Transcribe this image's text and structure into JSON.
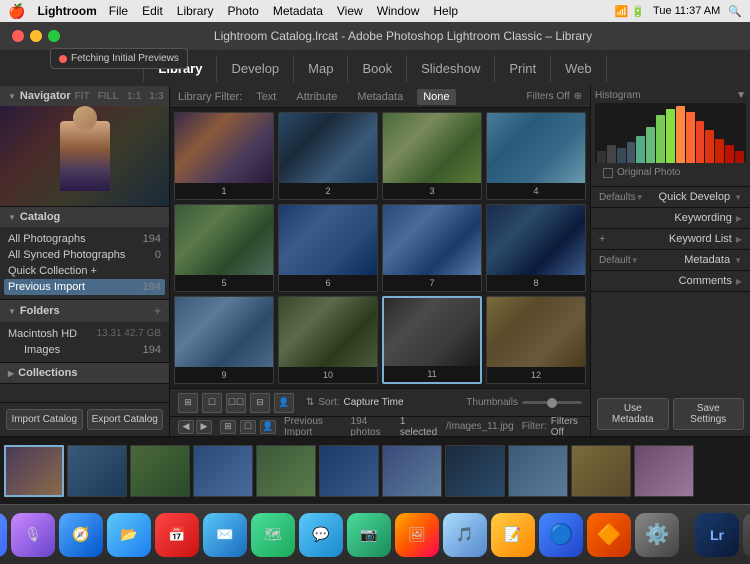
{
  "menubar": {
    "apple": "🍎",
    "app_name": "Lightroom",
    "menus": [
      "File",
      "Edit",
      "Library",
      "Photo",
      "Metadata",
      "View",
      "Window",
      "Help"
    ],
    "clock": "Tue 11:37 AM"
  },
  "titlebar": {
    "title": "Lightroom Catalog.lrcat - Adobe Photoshop Lightroom Classic – Library"
  },
  "notification": {
    "text": "Fetching Initial Previews"
  },
  "module_tabs": {
    "items": [
      "Library",
      "Develop",
      "Map",
      "Book",
      "Slideshow",
      "Print",
      "Web"
    ],
    "active": "Library"
  },
  "navigator": {
    "label": "Navigator",
    "zoom_levels": [
      "FIT",
      "FILL",
      "1:1",
      "1:3"
    ]
  },
  "catalog": {
    "label": "Catalog",
    "items": [
      {
        "name": "All Photographs",
        "count": "194"
      },
      {
        "name": "All Synced Photographs",
        "count": "0"
      },
      {
        "name": "Quick Collection +",
        "count": ""
      },
      {
        "name": "Previous Import",
        "count": "194"
      }
    ]
  },
  "folders": {
    "label": "Folders",
    "items": [
      {
        "name": "Macintosh HD",
        "info": "13.31 42.7 GB"
      },
      {
        "name": "Images",
        "count": "194",
        "indent": true
      }
    ]
  },
  "collections": {
    "label": "Collections"
  },
  "bottom_buttons": {
    "import": "Import Catalog",
    "export": "Export Catalog"
  },
  "filter_bar": {
    "label": "Library Filter:",
    "options": [
      "Text",
      "Attribute",
      "Metadata",
      "None"
    ],
    "active": "None",
    "right": "Filters Off"
  },
  "grid": {
    "cells": [
      {
        "num": "1",
        "class": "thumb-1"
      },
      {
        "num": "2",
        "class": "thumb-2"
      },
      {
        "num": "3",
        "class": "thumb-3"
      },
      {
        "num": "4",
        "class": "thumb-4"
      },
      {
        "num": "5",
        "class": "thumb-5"
      },
      {
        "num": "6",
        "class": "thumb-6"
      },
      {
        "num": "7",
        "class": "thumb-7"
      },
      {
        "num": "8",
        "class": "thumb-8"
      },
      {
        "num": "9",
        "class": "thumb-9"
      },
      {
        "num": "10",
        "class": "thumb-10"
      },
      {
        "num": "11",
        "class": "thumb-11"
      },
      {
        "num": "12",
        "class": "thumb-12"
      }
    ],
    "selected_index": 10
  },
  "grid_toolbar": {
    "sort_label": "Sort:",
    "sort_value": "Capture Time",
    "thumbnail_label": "Thumbnails"
  },
  "status_bar": {
    "prev_label": "Previous Import",
    "count": "194 photos",
    "selected": "1 selected",
    "filename": "/Images_11.jpg",
    "filter_label": "Filter:",
    "filter_value": "Filters Off"
  },
  "histogram": {
    "label": "Histogram",
    "original_photo_label": "Original Photo"
  },
  "right_options": [
    {
      "key": "Defaults",
      "label": "Quick Develop",
      "type": "dropdown"
    },
    {
      "key": "",
      "label": "Keywording",
      "type": "expand"
    },
    {
      "key": "",
      "label": "+",
      "subkey": "Keyword List",
      "type": "plus-expand"
    },
    {
      "key": "Default",
      "label": "Metadata",
      "type": "dropdown"
    },
    {
      "key": "",
      "label": "Comments",
      "type": "expand"
    }
  ],
  "right_btns": {
    "before": "Use Metadata",
    "after": "Save Settings"
  },
  "filmstrip": {
    "items": [
      "film-1",
      "film-2",
      "film-3",
      "film-4",
      "film-5",
      "film-6",
      "film-7",
      "film-8",
      "film-9",
      "film-10",
      "film-11"
    ],
    "selected_index": 0
  },
  "dock": {
    "icons": [
      {
        "name": "apple-icon",
        "class": "dock-apple",
        "symbol": "🍎"
      },
      {
        "name": "siri-icon",
        "class": "dock-siri",
        "symbol": "🎙"
      },
      {
        "name": "safari-icon",
        "class": "dock-safari",
        "symbol": "🧭"
      },
      {
        "name": "finder-icon",
        "class": "dock-finder",
        "symbol": "📂"
      },
      {
        "name": "calendar-icon",
        "class": "dock-cal",
        "symbol": "📅"
      },
      {
        "name": "mail-icon",
        "class": "dock-mail",
        "symbol": "✉️"
      },
      {
        "name": "maps-icon",
        "class": "dock-maps",
        "symbol": "🗺"
      },
      {
        "name": "messages-icon",
        "class": "dock-messages",
        "symbol": "💬"
      },
      {
        "name": "facetime-icon",
        "class": "dock-facetime",
        "symbol": "📷"
      },
      {
        "name": "photos-icon",
        "class": "dock-photos",
        "symbol": "🖼"
      },
      {
        "name": "music-icon",
        "class": "dock-app1",
        "symbol": "🎵"
      },
      {
        "name": "notes-icon",
        "class": "dock-app2",
        "symbol": "📝"
      },
      {
        "name": "settings-icon",
        "class": "dock-app3",
        "symbol": "⚙️"
      },
      {
        "name": "app4-icon",
        "class": "dock-app4",
        "symbol": "🔴"
      },
      {
        "name": "app5-icon",
        "class": "dock-app5",
        "symbol": "🔵"
      },
      {
        "name": "lr-icon",
        "class": "dock-lr",
        "symbol": "Lr"
      },
      {
        "name": "trash-icon",
        "class": "dock-app6",
        "symbol": "🗑"
      }
    ]
  }
}
